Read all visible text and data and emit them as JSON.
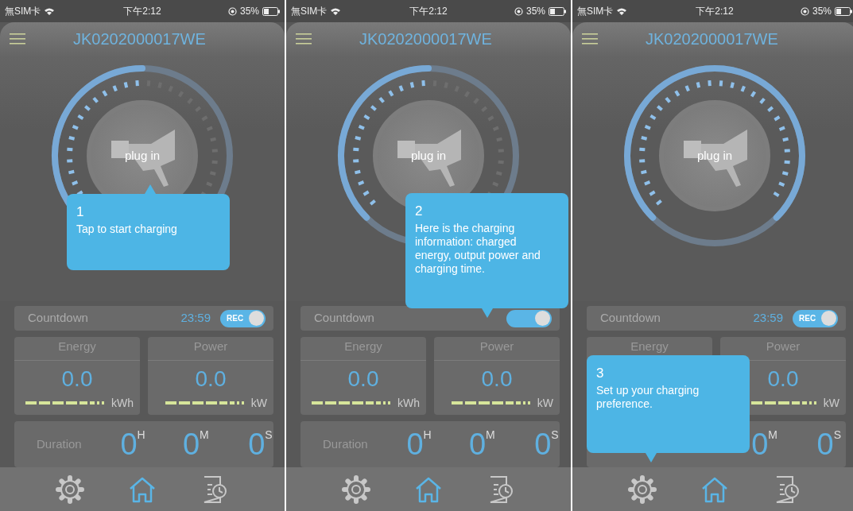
{
  "panels": [
    {
      "status_bar": {
        "carrier": "無SIM卡",
        "time": "下午2:12",
        "battery": "35%"
      },
      "title": "JK0202000017WE",
      "gauge": {
        "label": "plug in",
        "level": 0.5
      },
      "countdown": {
        "label": "Countdown",
        "value": "23:59",
        "toggle": {
          "label": "REC",
          "on": true
        }
      },
      "energy": {
        "title": "Energy",
        "value": "0.0",
        "unit": "kWh"
      },
      "power": {
        "title": "Power",
        "value": "0.0",
        "unit": "kW"
      },
      "duration": {
        "label": "Duration",
        "parts": [
          {
            "value": "0",
            "unit": "H"
          },
          {
            "value": "0",
            "unit": "M"
          },
          {
            "value": "0",
            "unit": "S"
          }
        ]
      },
      "nav": [
        {
          "kind": "settings",
          "selected": false
        },
        {
          "kind": "home",
          "selected": true
        },
        {
          "kind": "history",
          "selected": false
        }
      ],
      "tip": {
        "number": "1",
        "text": "Tap to start charging"
      }
    },
    {
      "status_bar": {
        "carrier": "無SIM卡",
        "time": "下午2:12",
        "battery": "35%"
      },
      "title": "JK0202000017WE",
      "gauge": {
        "label": "plug in",
        "level": 0.5
      },
      "countdown": {
        "label": "Countdown",
        "toggle": {
          "on": true
        }
      },
      "energy": {
        "title": "Energy",
        "value": "0.0",
        "unit": "kWh"
      },
      "power": {
        "title": "Power",
        "value": "0.0",
        "unit": "kW"
      },
      "duration": {
        "label": "Duration",
        "parts": [
          {
            "value": "0",
            "unit": "H"
          },
          {
            "value": "0",
            "unit": "M"
          },
          {
            "value": "0",
            "unit": "S"
          }
        ]
      },
      "nav": [
        {
          "kind": "settings",
          "selected": false
        },
        {
          "kind": "home",
          "selected": true
        },
        {
          "kind": "history",
          "selected": false
        }
      ],
      "tip": {
        "number": "2",
        "text": "Here is the charging information: charged energy, output power and charging time."
      }
    },
    {
      "status_bar": {
        "carrier": "無SIM卡",
        "time": "下午2:12",
        "battery": "35%"
      },
      "title": "JK0202000017WE",
      "gauge": {
        "label": "plug in",
        "level": 1
      },
      "countdown": {
        "label": "Countdown",
        "value": "23:59",
        "toggle": {
          "label": "REC",
          "on": true
        }
      },
      "energy": {
        "title": "Energy"
      },
      "power": {
        "title": "Power",
        "value": "0.0",
        "unit": "kW"
      },
      "duration": {
        "parts": [
          {
            "value": "0",
            "unit": "M"
          },
          {
            "value": "0",
            "unit": "S"
          }
        ]
      },
      "nav": [
        {
          "kind": "settings",
          "selected": false
        },
        {
          "kind": "home",
          "selected": true
        },
        {
          "kind": "history",
          "selected": false
        }
      ],
      "tip": {
        "number": "3",
        "text": "Set up your charging preference."
      }
    }
  ]
}
